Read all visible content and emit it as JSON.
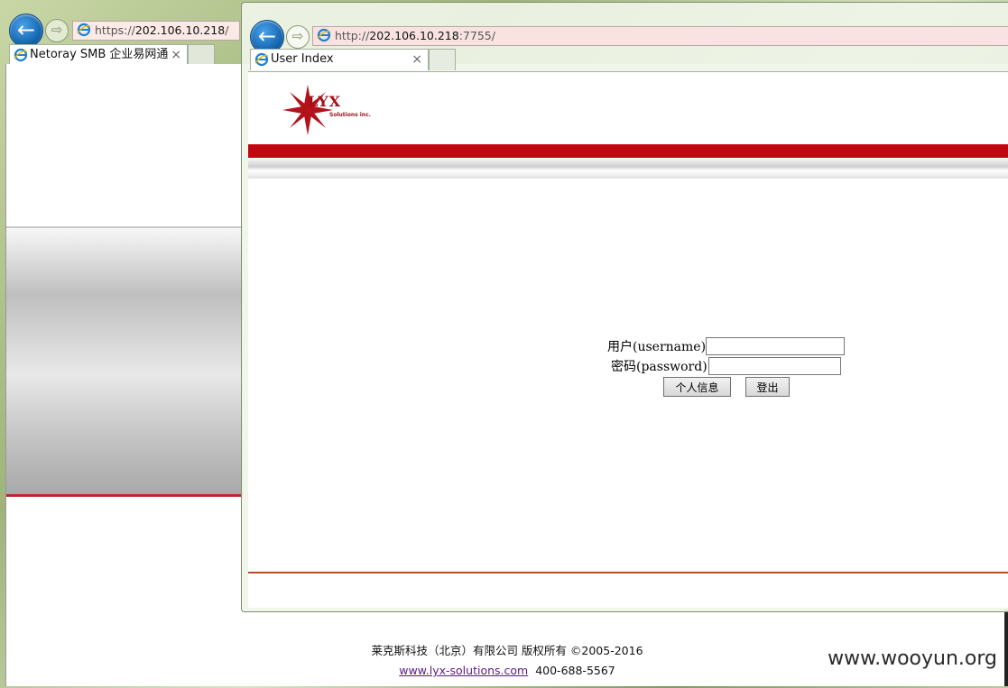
{
  "back_window": {
    "address_scheme": "https://",
    "address_host": "202.106.10.218",
    "address_path": "/",
    "tab_title": "Netoray SMB 企业易网通",
    "tab_close": "×"
  },
  "front_window": {
    "address_scheme": "http://",
    "address_host": "202.106.10.218",
    "address_path": ":7755/",
    "tab_title": "User Index",
    "tab_close": "×"
  },
  "logo": {
    "text": "LYX",
    "subtext": "Solutions inc."
  },
  "login": {
    "username_label": "用户(username)",
    "password_label": "密码(password)",
    "username_value": "",
    "password_value": "",
    "info_button": "个人信息",
    "logout_button": "登出"
  },
  "footer": {
    "copyright": "莱克斯科技（北京）有限公司 版权所有 ©2005-2016",
    "website": "www.lyx-solutions.com",
    "phone": "400-688-5567"
  },
  "watermark": "www.wooyun.org",
  "colors": {
    "brand_red": "#c0060f",
    "ie_blue": "#1d7fd6"
  }
}
